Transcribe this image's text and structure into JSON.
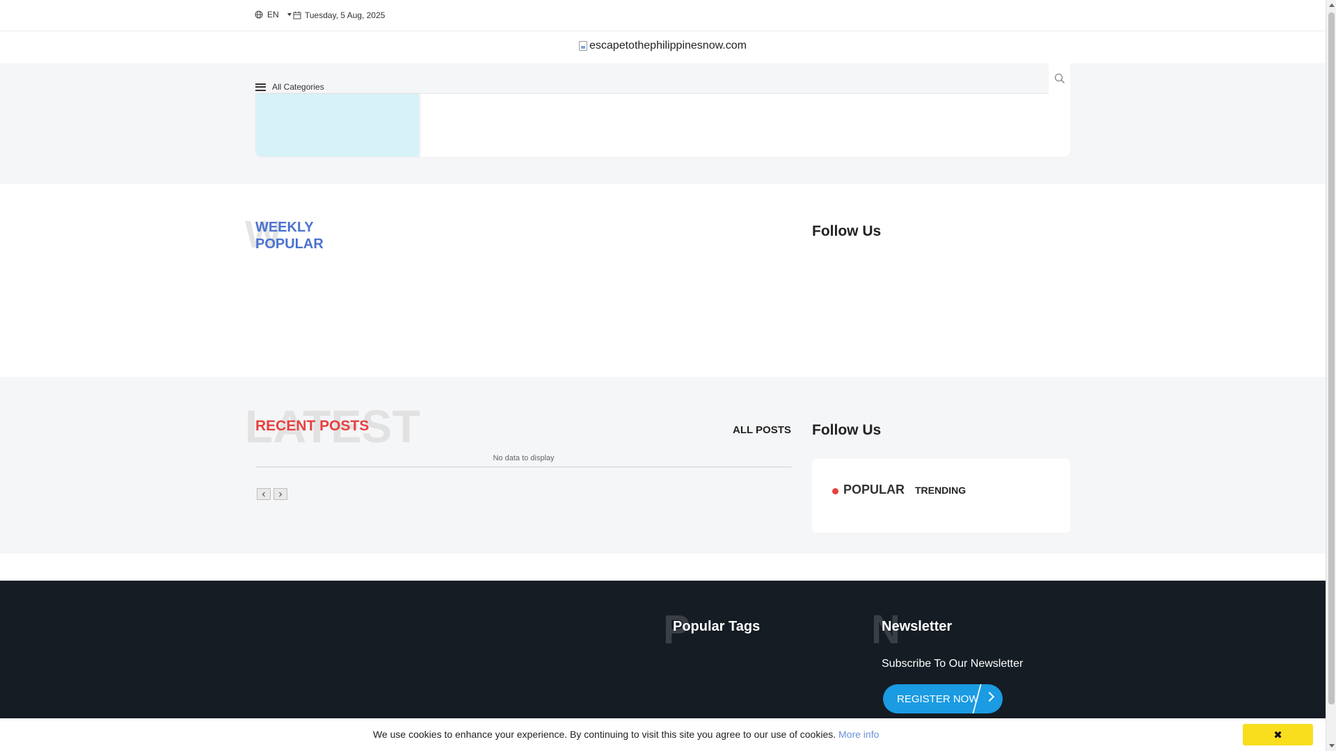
{
  "topbar": {
    "language": "EN",
    "date": "Tuesday, 5 Aug, 2025",
    "icons": [
      "globe-icon",
      "calendar-icon",
      "chevron-down-icon"
    ]
  },
  "header": {
    "logo_alt": "escapetothephilippinesnow.com"
  },
  "nav": {
    "all_categories": "All Categories",
    "icons": [
      "hamburger-icon",
      "search-icon"
    ]
  },
  "weekly": {
    "ghost_letter": "W",
    "title": "WEEKLY POPULAR"
  },
  "sidebar": {
    "follow_us_top": "Follow Us",
    "follow_us_bottom": "Follow Us",
    "tabs": {
      "popular": "POPULAR",
      "trending": "TRENDING"
    }
  },
  "recent": {
    "ghost_text": "LATEST",
    "title": "RECENT POSTS",
    "all_posts": "ALL POSTS",
    "empty_message": "No data to display",
    "pager_icons": [
      "chevron-left-icon",
      "chevron-right-icon"
    ]
  },
  "footer": {
    "tags_ghost": "P",
    "tags_title": "Popular Tags",
    "newsletter_ghost": "N",
    "newsletter_title": "Newsletter",
    "subscribe_text": "Subscribe To Our Newsletter",
    "register_label": "REGISTER NOW"
  },
  "cookie": {
    "message": "We use cookies to enhance your experience. By continuing to visit this site you agree to our use of cookies.",
    "more_info": "More info",
    "close_label": "✖"
  },
  "colors": {
    "accent_blue": "#4b72d0",
    "accent_red": "#e8403f",
    "footer_bg": "#151c24",
    "register_blue": "#1a9be2",
    "cookie_button": "#f9de1e"
  }
}
